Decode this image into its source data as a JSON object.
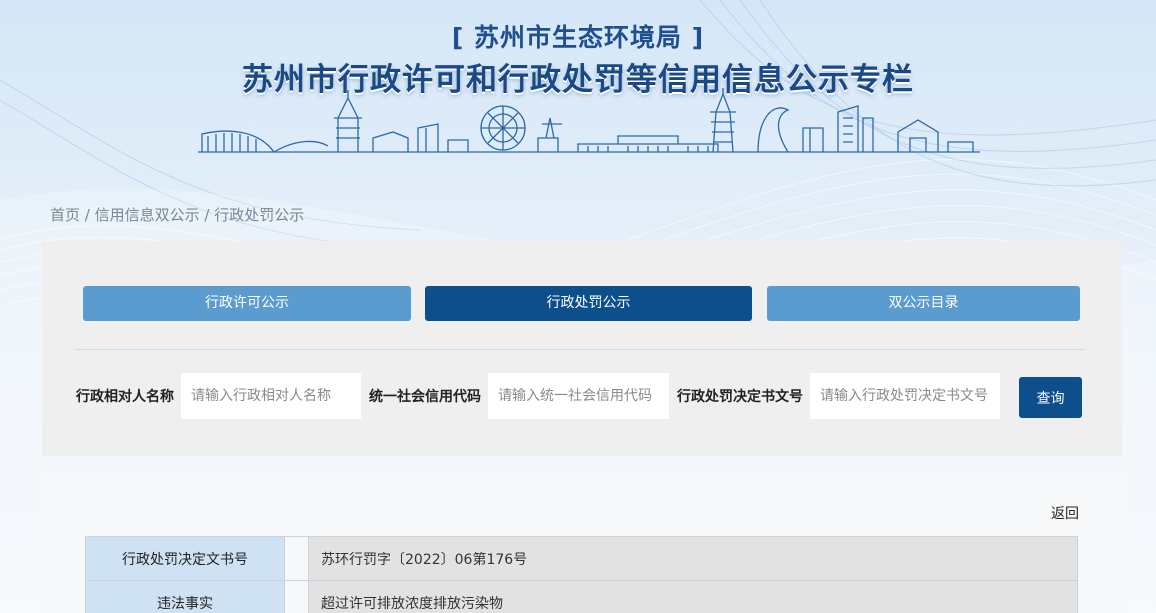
{
  "header": {
    "org": "[ 苏州市生态环境局 ]",
    "title": "苏州市行政许可和行政处罚等信用信息公示专栏"
  },
  "breadcrumb": {
    "home": "首页",
    "sep1": " / ",
    "level2": "信用信息双公示",
    "sep2": " / ",
    "level3": "行政处罚公示"
  },
  "tabs": [
    {
      "label": "行政许可公示",
      "active": false
    },
    {
      "label": "行政处罚公示",
      "active": true
    },
    {
      "label": "双公示目录",
      "active": false
    }
  ],
  "search": {
    "name_label": "行政相对人名称",
    "name_placeholder": "请输入行政相对人名称",
    "code_label": "统一社会信用代码",
    "code_placeholder": "请输入统一社会信用代码",
    "doc_label": "行政处罚决定书文号",
    "doc_placeholder": "请输入行政处罚决定书文号",
    "button": "查询"
  },
  "detail": {
    "back": "返回",
    "rows": [
      {
        "key": "行政处罚决定文书号",
        "value": "苏环行罚字〔2022〕06第176号"
      },
      {
        "key": "违法事实",
        "value": "超过许可排放浓度排放污染物"
      }
    ]
  },
  "colors": {
    "primary": "#0d4f8c",
    "tab_inactive": "#5a9ccf",
    "key_cell": "#cfe2f3"
  }
}
